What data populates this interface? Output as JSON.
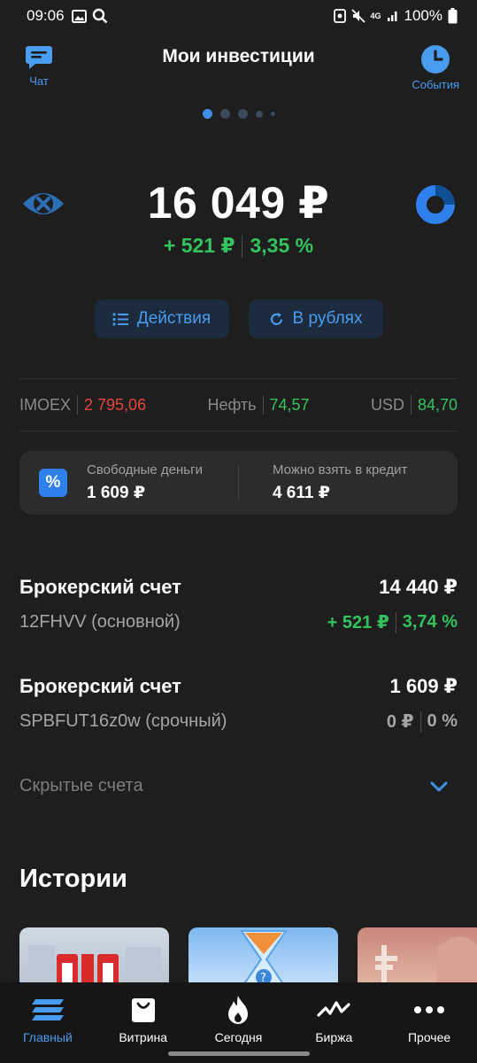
{
  "status_bar": {
    "time": "09:06",
    "battery": "100%",
    "network": "4G"
  },
  "header": {
    "title": "Мои инвестиции",
    "chat_label": "Чат",
    "events_label": "События",
    "accent": "#4a9cf0"
  },
  "pager": {
    "pages": 5,
    "active_index": 0
  },
  "portfolio": {
    "total": "16 049 ₽",
    "change_abs": "+ 521 ₽",
    "change_pct": "3,35 %"
  },
  "actions": {
    "actions_label": "Действия",
    "currency_label": "В рублях"
  },
  "tickers": [
    {
      "name": "IMOEX",
      "value": "2 795,06",
      "trend": "down"
    },
    {
      "name": "Нефть",
      "value": "74,57",
      "trend": "up"
    },
    {
      "name": "USD",
      "value": "84,70",
      "trend": "up"
    }
  ],
  "money": {
    "free_label": "Свободные деньги",
    "free_value": "1 609 ₽",
    "credit_label": "Можно взять в кредит",
    "credit_value": "4 611 ₽"
  },
  "accounts": [
    {
      "title": "Брокерский счет",
      "total": "14 440 ₽",
      "subtitle": "12FHVV (основной)",
      "change_abs": "+ 521 ₽",
      "change_pct": "3,74 %",
      "trend": "up"
    },
    {
      "title": "Брокерский счет",
      "total": "1 609 ₽",
      "subtitle": "SPBFUT16z0w (срочный)",
      "change_abs": "0 ₽",
      "change_pct": "0 %",
      "trend": "flat"
    }
  ],
  "hidden_accounts_label": "Скрытые счета",
  "stories_title": "Истории",
  "stories": [
    {
      "icon": "story-thumbnail-1"
    },
    {
      "icon": "story-thumbnail-2"
    },
    {
      "icon": "story-thumbnail-3"
    }
  ],
  "bottom_nav": [
    {
      "label": "Главный",
      "icon": "home-icon",
      "active": true
    },
    {
      "label": "Витрина",
      "icon": "shopping-bag-icon",
      "active": false
    },
    {
      "label": "Сегодня",
      "icon": "flame-icon",
      "active": false
    },
    {
      "label": "Биржа",
      "icon": "pulse-chart-icon",
      "active": false
    },
    {
      "label": "Прочее",
      "icon": "more-dots-icon",
      "active": false
    }
  ],
  "colors": {
    "background": "#1e1e1e",
    "positive": "#33c35e",
    "negative": "#e5463c",
    "accent": "#4a9cf0"
  }
}
